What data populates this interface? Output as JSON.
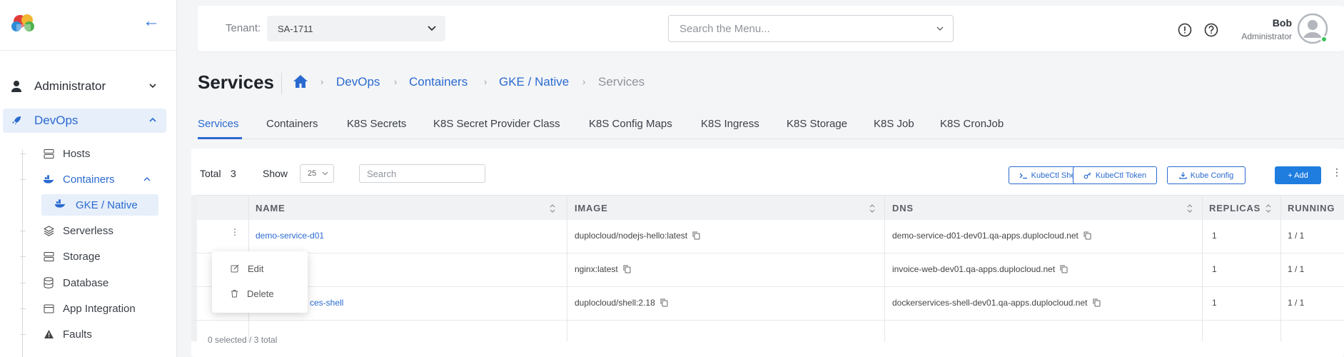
{
  "sidebar": {
    "back_arrow": "←",
    "administrator_label": "Administrator",
    "devops_label": "DevOps",
    "items": [
      {
        "label": "Hosts",
        "icon": "server-icon"
      },
      {
        "label": "Containers",
        "icon": "docker-icon"
      },
      {
        "label": "GKE / Native",
        "icon": "docker-icon"
      },
      {
        "label": "Serverless",
        "icon": "layers-icon"
      },
      {
        "label": "Storage",
        "icon": "server-icon"
      },
      {
        "label": "Database",
        "icon": "database-icon"
      },
      {
        "label": "App Integration",
        "icon": "window-icon"
      },
      {
        "label": "Faults",
        "icon": "warning-icon"
      }
    ]
  },
  "header": {
    "tenant_label": "Tenant:",
    "tenant_value": "SA-1711",
    "menu_search_placeholder": "Search the Menu...",
    "user_name": "Bob",
    "user_role": "Administrator"
  },
  "page": {
    "title": "Services",
    "breadcrumb": [
      "DevOps",
      "Containers",
      "GKE / Native",
      "Services"
    ],
    "breadcrumb_sep": "›"
  },
  "tabs": [
    "Services",
    "Containers",
    "K8S Secrets",
    "K8S Secret Provider Class",
    "K8S Config Maps",
    "K8S Ingress",
    "K8S Storage",
    "K8S Job",
    "K8S CronJob"
  ],
  "toolbar": {
    "total_label": "Total",
    "total_value": "3",
    "show_label": "Show",
    "page_size": "25",
    "search_placeholder": "Search",
    "kubectl_shell": "KubeCtl Shell",
    "kubectl_token": "KubeCtl Token",
    "kube_config": "Kube Config",
    "add": "+ Add"
  },
  "table": {
    "columns": [
      "NAME",
      "IMAGE",
      "DNS",
      "REPLICAS",
      "RUNNING"
    ],
    "rows": [
      {
        "name": "demo-service-d01",
        "image": "duplocloud/nodejs-hello:latest",
        "dns": "demo-service-d01-dev01.qa-apps.duplocloud.net",
        "replicas": "1",
        "running": "1 / 1"
      },
      {
        "name": "",
        "image": "nginx:latest",
        "dns": "invoice-web-dev01.qa-apps.duplocloud.net",
        "replicas": "1",
        "running": "1 / 1"
      },
      {
        "name": "ces-shell",
        "image": "duplocloud/shell:2.18",
        "dns": "dockerservices-shell-dev01.qa-apps.duplocloud.net",
        "replicas": "1",
        "running": "1 / 1"
      }
    ]
  },
  "context_menu": {
    "edit": "Edit",
    "delete": "Delete"
  },
  "footer": {
    "selection": "0 selected / 3 total"
  },
  "colors": {
    "accent": "#2a6ad0",
    "primary_button": "#1f7de0",
    "online": "#3cc35a"
  }
}
